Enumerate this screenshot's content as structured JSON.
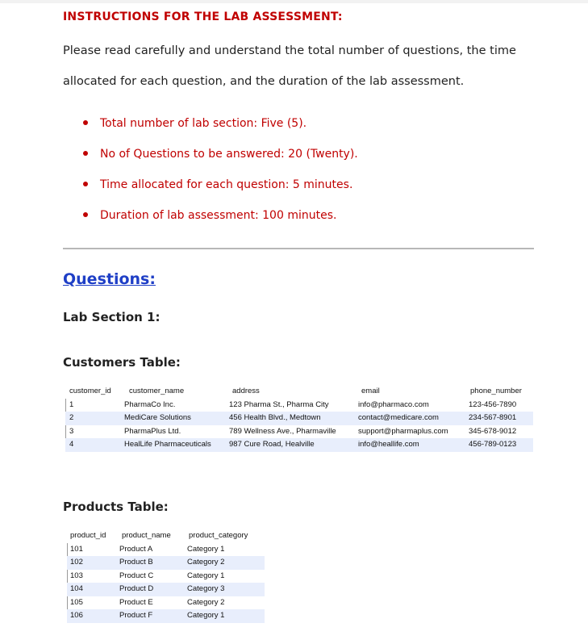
{
  "header": {
    "title": "INSTRUCTIONS FOR THE LAB ASSESSMENT:"
  },
  "intro": {
    "line1": "Please read carefully and understand the total number of questions, the time",
    "line2": "allocated for each question, and the duration of the lab assessment."
  },
  "bullets": [
    "Total number of lab section: Five (5).",
    "No of Questions to be answered: 20 (Twenty).",
    "Time allocated for each question: 5 minutes.",
    "Duration of lab assessment: 100 minutes."
  ],
  "questions_title": "Questions:",
  "section_title": "Lab Section 1:",
  "customers": {
    "title": "Customers Table:",
    "columns": [
      "customer_id",
      "customer_name",
      "address",
      "email",
      "phone_number"
    ],
    "rows": [
      [
        "1",
        "PharmaCo Inc.",
        "123 Pharma St., Pharma City",
        "info@pharmaco.com",
        "123-456-7890"
      ],
      [
        "2",
        "MediCare Solutions",
        "456 Health Blvd., Medtown",
        "contact@medicare.com",
        "234-567-8901"
      ],
      [
        "3",
        "PharmaPlus Ltd.",
        "789 Wellness Ave., Pharmaville",
        "support@pharmaplus.com",
        "345-678-9012"
      ],
      [
        "4",
        "HealLife Pharmaceuticals",
        "987 Cure Road, Healville",
        "info@heallife.com",
        "456-789-0123"
      ]
    ]
  },
  "products": {
    "title": "Products Table:",
    "columns": [
      "product_id",
      "product_name",
      "product_category"
    ],
    "rows": [
      [
        "101",
        "Product A",
        "Category 1"
      ],
      [
        "102",
        "Product B",
        "Category 2"
      ],
      [
        "103",
        "Product C",
        "Category 1"
      ],
      [
        "104",
        "Product D",
        "Category 3"
      ],
      [
        "105",
        "Product E",
        "Category 2"
      ],
      [
        "106",
        "Product F",
        "Category 1"
      ]
    ]
  }
}
